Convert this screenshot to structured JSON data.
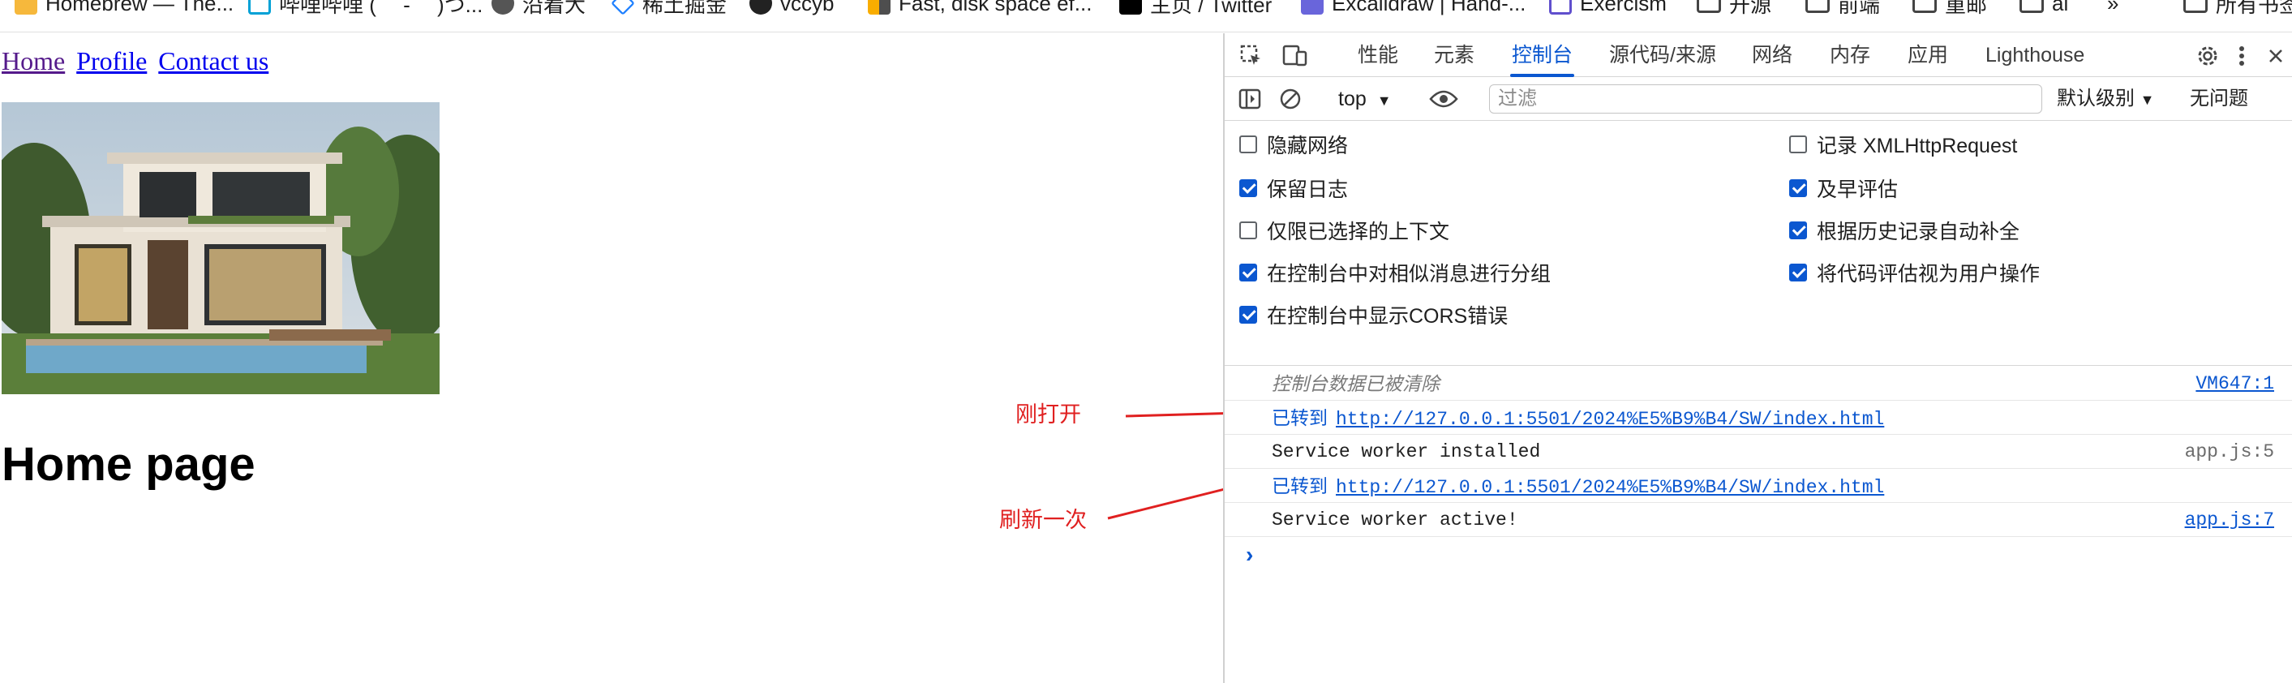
{
  "bookmarks": [
    {
      "label": "Homebrew — The...",
      "icon": "homebrew-icon"
    },
    {
      "label": "哔哩哔哩 ( ゜- ゜)つ...",
      "icon": "bilibili-icon"
    },
    {
      "label": "沿着大",
      "icon": "globe-icon"
    },
    {
      "label": "稀土掘金",
      "icon": "juejin-icon"
    },
    {
      "label": "vccyb",
      "icon": "github-icon"
    },
    {
      "label": "Fast, disk space ef...",
      "icon": "pnpm-icon"
    },
    {
      "label": "主页 / Twitter",
      "icon": "x-icon"
    },
    {
      "label": "Excalidraw | Hand-...",
      "icon": "excalidraw-icon"
    },
    {
      "label": "Exercism",
      "icon": "exercism-icon"
    },
    {
      "label": "开源",
      "icon": "folder-icon"
    },
    {
      "label": "前端",
      "icon": "folder-icon"
    },
    {
      "label": "重邮",
      "icon": "folder-icon"
    },
    {
      "label": "ai",
      "icon": "folder-icon"
    },
    {
      "label": "»",
      "icon": "more-icon"
    },
    {
      "label": "所有书签",
      "icon": "folder-icon"
    }
  ],
  "page": {
    "nav": {
      "home": "Home",
      "profile": "Profile",
      "contact": "Contact us"
    },
    "title": "Home page"
  },
  "annotations": {
    "first_open": "刚打开",
    "refresh_once": "刷新一次"
  },
  "devtools": {
    "tabs": [
      "性能",
      "元素",
      "控制台",
      "源代码/来源",
      "网络",
      "内存",
      "应用",
      "Lighthouse"
    ],
    "active_tab": "控制台",
    "toolbar": {
      "context": "top",
      "filter_placeholder": "过滤",
      "levels": "默认级别",
      "issues": "无问题"
    },
    "settings": {
      "hide_network": {
        "label": "隐藏网络",
        "checked": false
      },
      "preserve_log": {
        "label": "保留日志",
        "checked": true
      },
      "selected_context_only": {
        "label": "仅限已选择的上下文",
        "checked": false
      },
      "group_similar": {
        "label": "在控制台中对相似消息进行分组",
        "checked": true
      },
      "show_cors": {
        "label": "在控制台中显示CORS错误",
        "checked": true
      },
      "log_xhr": {
        "label": "记录 XMLHttpRequest",
        "checked": false
      },
      "eager_eval": {
        "label": "及早评估",
        "checked": true
      },
      "autocomplete_history": {
        "label": "根据历史记录自动补全",
        "checked": true
      },
      "eval_user_activation": {
        "label": "将代码评估视为用户操作",
        "checked": true
      }
    },
    "console": [
      {
        "kind": "cleared",
        "text": "控制台数据已被清除",
        "source": "VM647:1"
      },
      {
        "kind": "navigated",
        "text": "已转到",
        "url": "http://127.0.0.1:5501/2024%E5%B9%B4/SW/index.html"
      },
      {
        "kind": "log",
        "text": "Service worker installed",
        "source": "app.js:5"
      },
      {
        "kind": "navigated",
        "text": "已转到",
        "url": "http://127.0.0.1:5501/2024%E5%B9%B4/SW/index.html"
      },
      {
        "kind": "log",
        "text": "Service worker active!",
        "source": "app.js:7"
      }
    ],
    "prompt": "›"
  },
  "colors": {
    "accent": "#0b57d0",
    "annotation": "#e02020",
    "link": "#0000ee",
    "visited": "#551a8b"
  }
}
